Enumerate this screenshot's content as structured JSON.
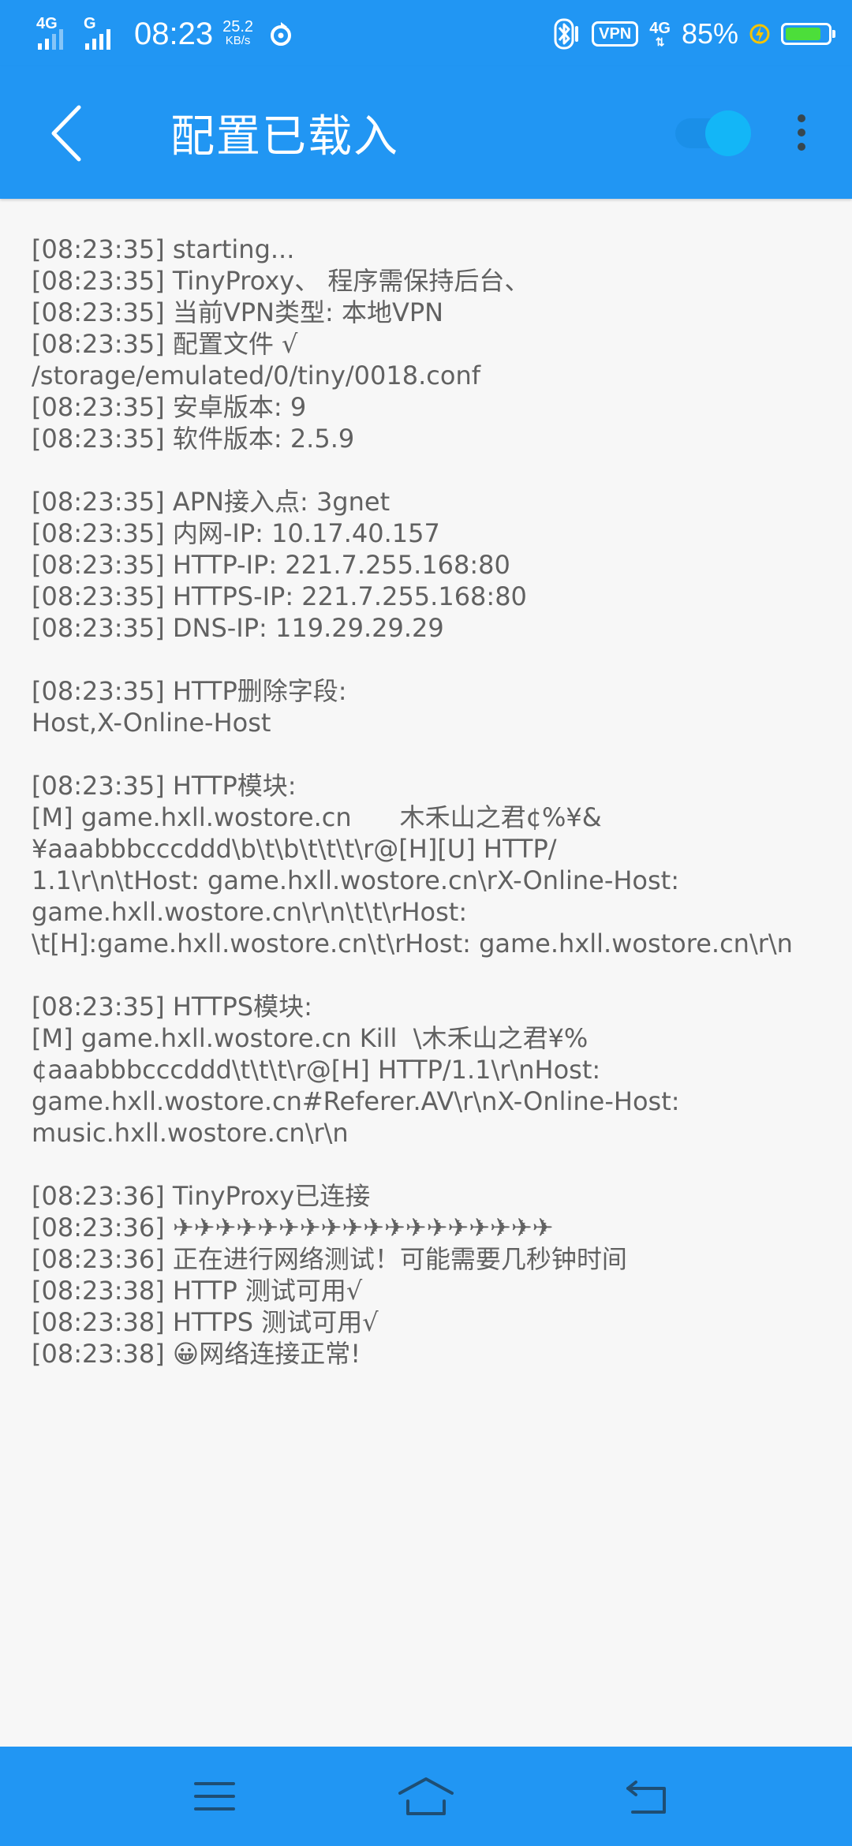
{
  "status_bar": {
    "sim1_net": "4G",
    "sim2_net": "G",
    "time": "08:23",
    "speed_value": "25.2",
    "speed_unit": "KB/s",
    "vpn_label": "VPN",
    "net_4g": "4G",
    "battery_percent": "85%",
    "battery_level": 0.85,
    "battery_color": "#4cde3a"
  },
  "app_bar": {
    "title": "配置已载入",
    "toggle_on": true,
    "accent_color": "#2196f3",
    "toggle_color": "#13b6f7"
  },
  "log": {
    "lines": [
      "[08:23:35] starting...",
      "[08:23:35] TinyProxy、 程序需保持后台、",
      "[08:23:35] 当前VPN类型: 本地VPN",
      "[08:23:35] 配置文件 √",
      "/storage/emulated/0/tiny/0018.conf",
      "[08:23:35] 安卓版本: 9",
      "[08:23:35] 软件版本: 2.5.9",
      "",
      "[08:23:35] APN接入点: 3gnet",
      "[08:23:35] 内网-IP: 10.17.40.157",
      "[08:23:35] HTTP-IP: 221.7.255.168:80",
      "[08:23:35] HTTPS-IP: 221.7.255.168:80",
      "[08:23:35] DNS-IP: 119.29.29.29",
      "",
      "[08:23:35] HTTP删除字段:",
      "Host,X-Online-Host",
      "",
      "[08:23:35] HTTP模块:",
      "[M] game.hxll.wostore.cn      木禾山之君¢%¥&",
      "¥aaabbbcccddd\\b\\t\\b\\t\\t\\t\\r@[H][U] HTTP/",
      "1.1\\r\\n\\tHost: game.hxll.wostore.cn\\rX-Online-Host:",
      "game.hxll.wostore.cn\\r\\n\\t\\t\\rHost:",
      "\\t[H]:game.hxll.wostore.cn\\t\\rHost: game.hxll.wostore.cn\\r\\n",
      "",
      "[08:23:35] HTTPS模块:",
      "[M] game.hxll.wostore.cn Kill  \\木禾山之君¥%",
      "¢aaabbbcccddd\\t\\t\\t\\r@[H] HTTP/1.1\\r\\nHost:",
      "game.hxll.wostore.cn#Referer.AV\\r\\nX-Online-Host:",
      "music.hxll.wostore.cn\\r\\n",
      "",
      "[08:23:36] TinyProxy已连接",
      "[08:23:36] ✈✈✈✈✈✈✈✈✈✈✈✈✈✈✈✈✈✈",
      "[08:23:36] 正在进行网络测试！可能需要几秒钟时间",
      "[08:23:38] HTTP 测试可用√",
      "[08:23:38] HTTPS 测试可用√",
      "[08:23:38] 😀网络连接正常!"
    ],
    "text_color": "#616161"
  },
  "nav_bar": {
    "icons": [
      "menu-icon",
      "home-icon",
      "back-icon"
    ]
  }
}
